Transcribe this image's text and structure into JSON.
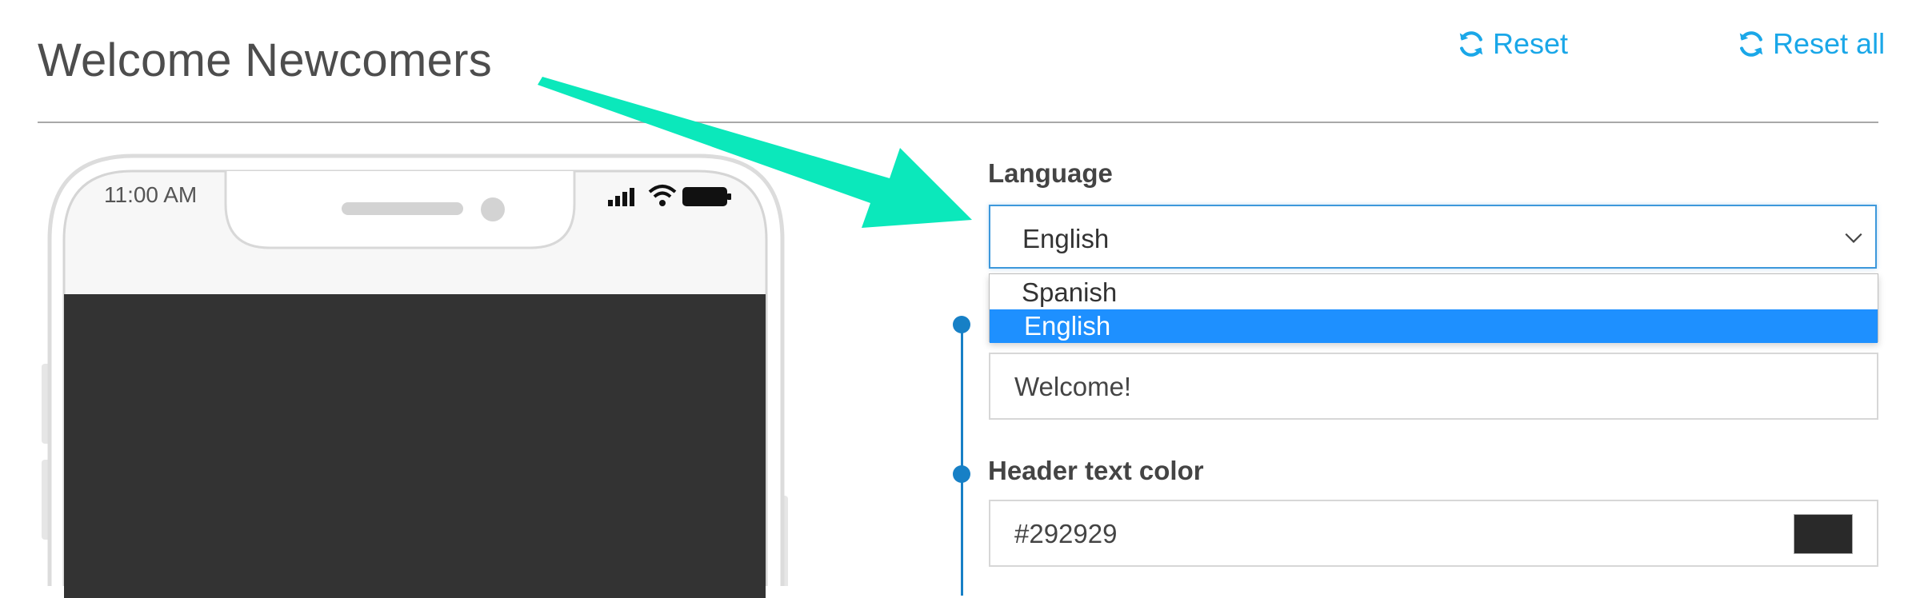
{
  "header": {
    "title": "Welcome Newcomers",
    "reset_label": "Reset",
    "reset_all_label": "Reset all"
  },
  "phone": {
    "time": "11:00 AM"
  },
  "form": {
    "language_label": "Language",
    "language_selected": "English",
    "language_options": [
      "Spanish",
      "English"
    ],
    "header_text_value": "Welcome!",
    "header_color_label": "Header text color",
    "header_color_value": "#292929"
  },
  "colors": {
    "accent": "#1aa7e8",
    "arrow": "#0be8bb",
    "timeline": "#1780c6",
    "highlight": "#1e90ff"
  },
  "icons": {
    "reset": "refresh-icon",
    "dropdown": "chevron-down-icon"
  }
}
